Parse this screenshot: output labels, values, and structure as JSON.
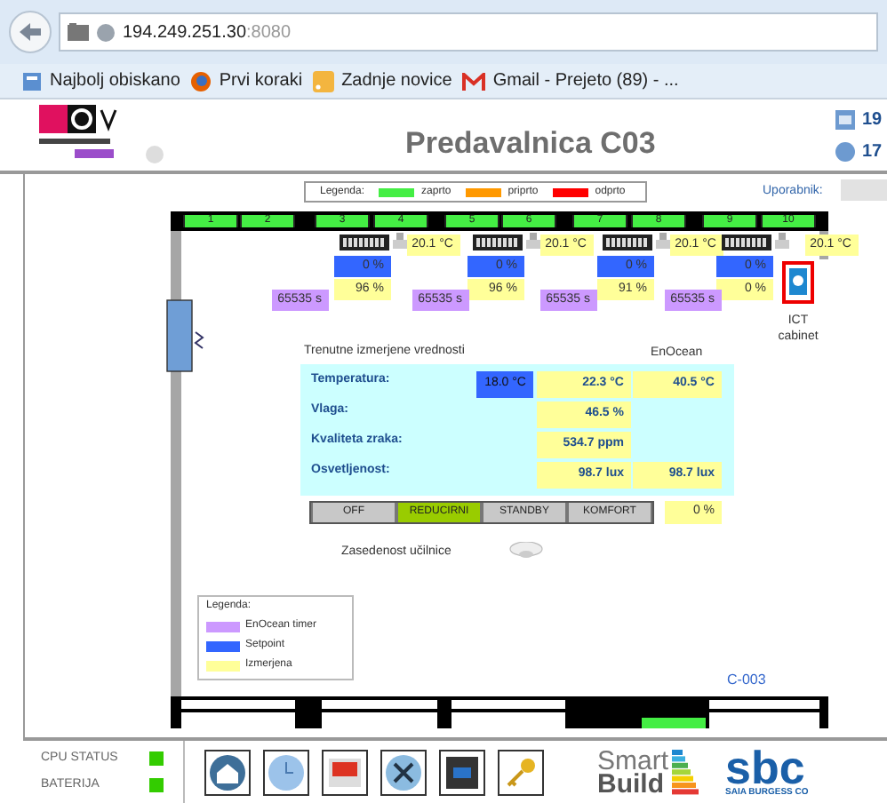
{
  "browser": {
    "host": "194.249.251.30",
    "port": ":8080",
    "bookmarks": [
      {
        "label": "Najbolj obiskano",
        "kind": "page"
      },
      {
        "label": "Prvi koraki",
        "kind": "fox"
      },
      {
        "label": "Zadnje novice",
        "kind": "feed"
      },
      {
        "label": "Gmail - Prejeto (89) - ...",
        "kind": "mail"
      }
    ]
  },
  "header": {
    "title": "Predavalnica C03",
    "info": [
      "19",
      "17"
    ]
  },
  "window_legend": {
    "label": "Legenda:",
    "items": [
      {
        "label": "zaprto",
        "color": "#44ee44"
      },
      {
        "label": "priprto",
        "color": "#ff9900"
      },
      {
        "label": "odprto",
        "color": "#ff0000"
      }
    ]
  },
  "user": {
    "label": "Uporabnik:"
  },
  "windows": [
    {
      "label": "1",
      "color": "#44ee44"
    },
    {
      "label": "2",
      "color": "#44ee44"
    },
    {
      "label": "3",
      "color": "#44ee44"
    },
    {
      "label": "4",
      "color": "#44ee44"
    },
    {
      "label": "5",
      "color": "#44ee44"
    },
    {
      "label": "6",
      "color": "#44ee44"
    },
    {
      "label": "7",
      "color": "#44ee44"
    },
    {
      "label": "8",
      "color": "#44ee44"
    },
    {
      "label": "9",
      "color": "#44ee44"
    },
    {
      "label": "10",
      "color": "#44ee44"
    }
  ],
  "radiators": [
    {
      "temperature": "20.1 °C",
      "setpoint": "0 %",
      "valve": "96 %",
      "timer": "65535 s"
    },
    {
      "temperature": "20.1 °C",
      "setpoint": "0 %",
      "valve": "96 %",
      "timer": "65535 s"
    },
    {
      "temperature": "20.1 °C",
      "setpoint": "0 %",
      "valve": "91 %",
      "timer": "65535 s"
    },
    {
      "temperature": "20.1 °C",
      "setpoint": "0 %",
      "valve": "0 %",
      "timer": "65535 s"
    }
  ],
  "ict": {
    "label": "ICT cabinet"
  },
  "measurements": {
    "title": "Trenutne izmerjene vrednosti",
    "column_4": "EnOcean",
    "rows": [
      {
        "label": "Temperatura:",
        "setpoint": "18.0 °C",
        "value": "22.3 °C",
        "enocean": "40.5 °C"
      },
      {
        "label": "Vlaga:",
        "value": "46.5 %"
      },
      {
        "label": "Kvaliteta zraka:",
        "value": "534.7 ppm"
      },
      {
        "label": "Osvetljenost:",
        "value": "98.7 lux",
        "enocean": "98.7 lux"
      }
    ]
  },
  "modes": [
    {
      "label": "OFF",
      "selected": false
    },
    {
      "label": "REDUCIRNI",
      "selected": true
    },
    {
      "label": "STANDBY",
      "selected": false
    },
    {
      "label": "KOMFORT",
      "selected": false
    }
  ],
  "mode_output": "0 %",
  "occupancy": {
    "label": "Zasedenost učilnice"
  },
  "legend": {
    "title": "Legenda:",
    "items": [
      {
        "label": "EnOcean timer",
        "color": "#cc99ff"
      },
      {
        "label": "Setpoint",
        "color": "#3366ff"
      },
      {
        "label": "Izmerjena",
        "color": "#ffff99"
      }
    ]
  },
  "room_code": "C-003",
  "status": [
    {
      "label": "CPU STATUS",
      "ok": true
    },
    {
      "label": "BATERIJA",
      "ok": true
    }
  ],
  "logos": {
    "smart": "Smart",
    "build": "Build",
    "sbc": "sbc",
    "sbc_caption": "SAIA BURGESS CO"
  }
}
